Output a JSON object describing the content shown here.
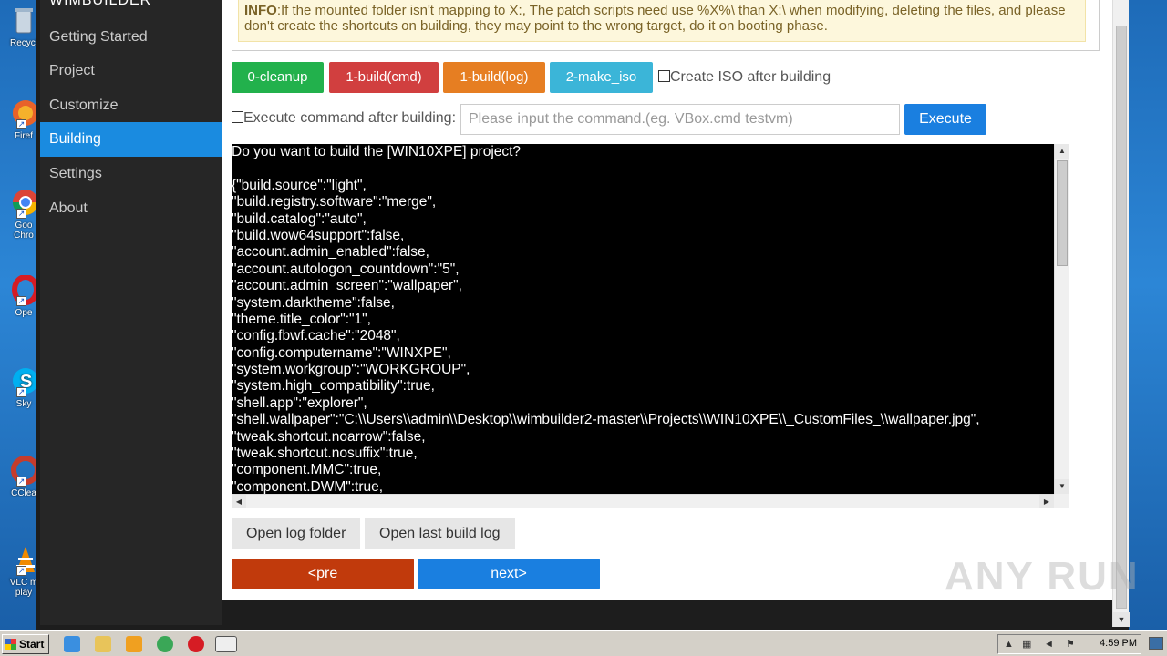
{
  "desktop": {
    "icons": [
      {
        "label": "Recycl",
        "color": "#9fb6cc"
      },
      {
        "label": "Firef",
        "color": "#e8622a"
      },
      {
        "label": "Goo Chro",
        "color": "#3aa757"
      },
      {
        "label": "Ope",
        "color": "#d61c24"
      },
      {
        "label": "Sky",
        "color": "#00aff0"
      },
      {
        "label": "CClea",
        "color": "#c63c2c"
      },
      {
        "label": "VLC m play",
        "color": "#f08a00"
      }
    ]
  },
  "app": {
    "brand": "WIMBUILDER",
    "nav": [
      {
        "label": "Getting Started"
      },
      {
        "label": "Project"
      },
      {
        "label": "Customize"
      },
      {
        "label": "Building",
        "active": true
      },
      {
        "label": "Settings"
      },
      {
        "label": "About"
      }
    ],
    "info": {
      "title": "INFO",
      "text": ":If the mounted folder isn't mapping to X:, The patch scripts need use %X%\\ than X:\\ when modifying, deleting the files, and please don't create the shortcuts on building, they may point to the wrong target, do it on booting phase."
    },
    "actions": {
      "cleanup": "0-cleanup",
      "build_cmd": "1-build(cmd)",
      "build_log": "1-build(log)",
      "make_iso": "2-make_iso",
      "create_iso_label": "Create ISO after building",
      "exec_label": "Execute command after building:",
      "cmd_placeholder": "Please input the command.(eg. VBox.cmd testvm)",
      "execute": "Execute"
    },
    "colors": {
      "cleanup": "#22b14c",
      "build_cmd": "#d13f3f",
      "build_log": "#e67e22",
      "make_iso": "#3bb5d8",
      "execute": "#1a7fe0",
      "pre": "#c13a0c",
      "next": "#1a7fe0"
    },
    "console": {
      "lines": [
        "Do you want to build the [WIN10XPE] project?",
        "",
        "{\"build.source\":\"light\",",
        "\"build.registry.software\":\"merge\",",
        "\"build.catalog\":\"auto\",",
        "\"build.wow64support\":false,",
        "\"account.admin_enabled\":false,",
        "\"account.autologon_countdown\":\"5\",",
        "\"account.admin_screen\":\"wallpaper\",",
        "\"system.darktheme\":false,",
        "\"theme.title_color\":\"1\",",
        "\"config.fbwf.cache\":\"2048\",",
        "\"config.computername\":\"WINXPE\",",
        "\"system.workgroup\":\"WORKGROUP\",",
        "\"system.high_compatibility\":true,",
        "\"shell.app\":\"explorer\",",
        "\"shell.wallpaper\":\"C:\\\\Users\\\\admin\\\\Desktop\\\\wimbuilder2-master\\\\Projects\\\\WIN10XPE\\\\_CustomFiles_\\\\wallpaper.jpg\",",
        "\"tweak.shortcut.noarrow\":false,",
        "\"tweak.shortcut.nosuffix\":true,",
        "\"component.MMC\":true,",
        "\"component.DWM\":true,"
      ]
    },
    "bottom": {
      "open_log_folder": "Open log folder",
      "open_last_log": "Open last build log",
      "pre": "<pre",
      "next": "next>"
    },
    "watermark": "ANY RUN"
  },
  "taskbar": {
    "start": "Start",
    "clock": "4:59 PM"
  }
}
